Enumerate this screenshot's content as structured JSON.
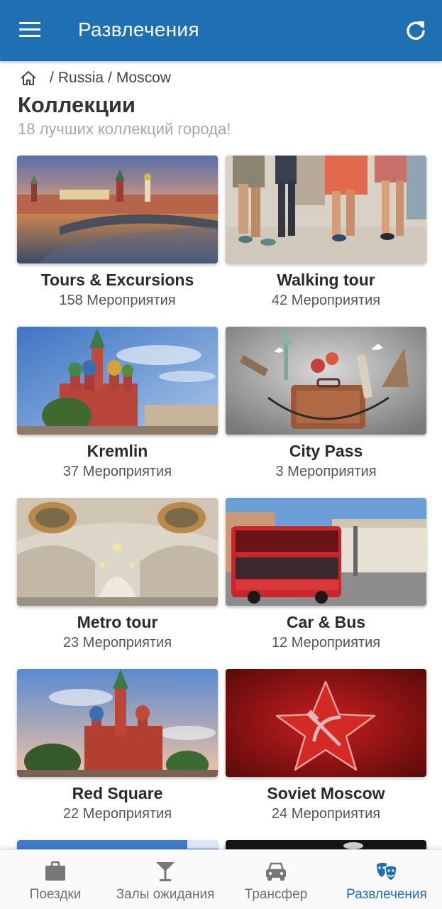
{
  "appbar": {
    "title": "Развлечения",
    "menu_icon": "hamburger-menu-icon",
    "refresh_icon": "refresh-icon",
    "color": "#1e70b3"
  },
  "breadcrumb": {
    "home_icon": "home-icon",
    "separator": "/",
    "items": [
      "Russia",
      "Moscow"
    ]
  },
  "page": {
    "title": "Коллекции",
    "subtitle": "18 лучших коллекций города!"
  },
  "collections": [
    {
      "name": "Tours & Excursions",
      "count": "158 Мероприятия",
      "image": "moscow-kremlin-river-sunset"
    },
    {
      "name": "Walking tour",
      "count": "42 Мероприятия",
      "image": "walking-people-legs"
    },
    {
      "name": "Kremlin",
      "count": "37 Мероприятия",
      "image": "st-basils-cathedral"
    },
    {
      "name": "City Pass",
      "count": "3 Мероприятия",
      "image": "suitcase-landmarks"
    },
    {
      "name": "Metro tour",
      "count": "23 Мероприятия",
      "image": "metro-station-hall"
    },
    {
      "name": "Car & Bus",
      "count": "12 Мероприятия",
      "image": "red-double-decker-bus"
    },
    {
      "name": "Red Square",
      "count": "22 Мероприятия",
      "image": "st-basils-cathedral-sky"
    },
    {
      "name": "Soviet Moscow",
      "count": "24 Мероприятия",
      "image": "red-star-hammer-sickle"
    }
  ],
  "bottom_nav": {
    "items": [
      {
        "label": "Поездки",
        "icon": "briefcase-icon",
        "active": false
      },
      {
        "label": "Залы ожидания",
        "icon": "cocktail-glass-icon",
        "active": false
      },
      {
        "label": "Трансфер",
        "icon": "car-icon",
        "active": false
      },
      {
        "label": "Развлечения",
        "icon": "theater-masks-icon",
        "active": true
      }
    ],
    "active_color": "#1e70b3"
  }
}
